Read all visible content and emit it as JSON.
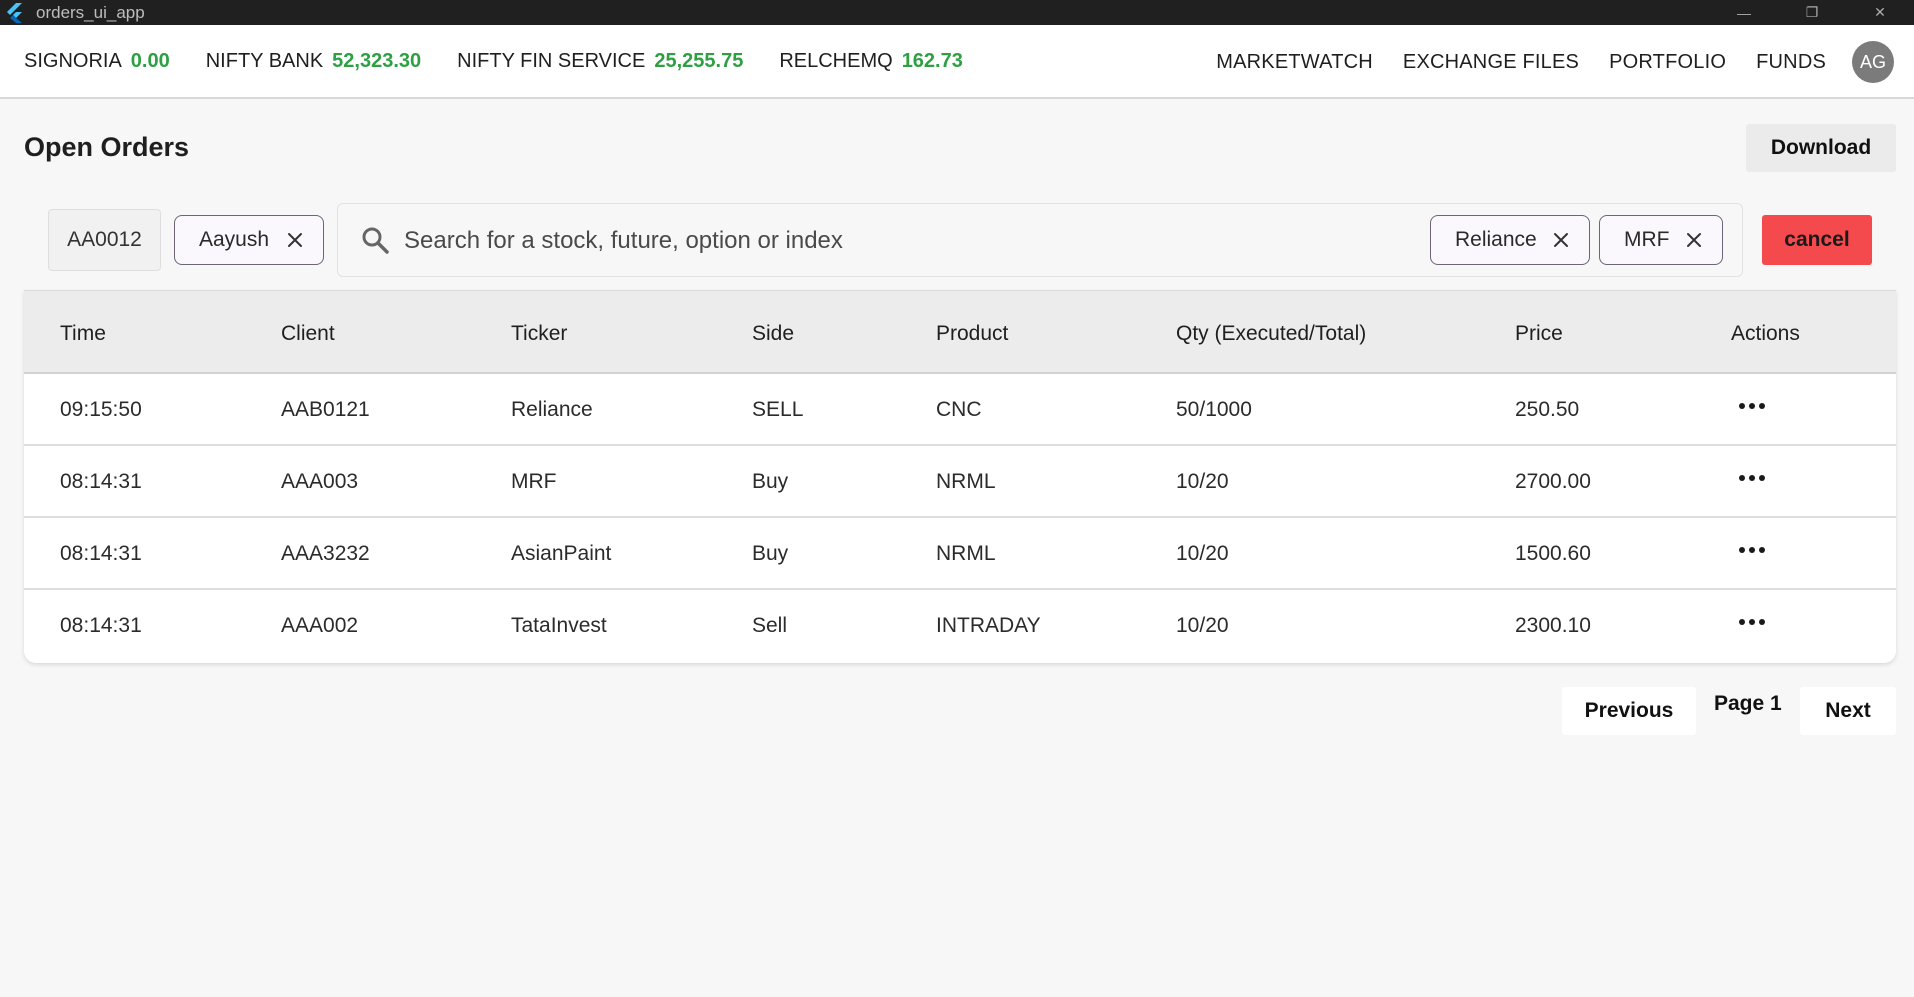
{
  "window": {
    "title": "orders_ui_app",
    "minimize_glyph": "—",
    "restore_glyph": "❐",
    "close_glyph": "✕"
  },
  "topnav": {
    "tickers": [
      {
        "name": "SIGNORIA",
        "value": "0.00"
      },
      {
        "name": "NIFTY BANK",
        "value": "52,323.30"
      },
      {
        "name": "NIFTY FIN SERVICE",
        "value": "25,255.75"
      },
      {
        "name": "RELCHEMQ",
        "value": "162.73"
      }
    ],
    "links": [
      "MARKETWATCH",
      "EXCHANGE FILES",
      "PORTFOLIO",
      "FUNDS"
    ],
    "avatar": "AG"
  },
  "page": {
    "title": "Open Orders",
    "download_label": "Download"
  },
  "filters": {
    "client_code": "AA0012",
    "client_chip": "Aayush",
    "search_placeholder": "Search for a stock, future, option or index",
    "stock_chips": [
      "Reliance",
      "MRF"
    ],
    "cancel_label": "cancel"
  },
  "table": {
    "columns": [
      "Time",
      "Client",
      "Ticker",
      "Side",
      "Product",
      "Qty (Executed/Total)",
      "Price",
      "Actions"
    ],
    "rows": [
      {
        "time": "09:15:50",
        "client": "AAB0121",
        "ticker": "Reliance",
        "side": "SELL",
        "product": "CNC",
        "qty": "50/1000",
        "price": "250.50"
      },
      {
        "time": "08:14:31",
        "client": "AAA003",
        "ticker": "MRF",
        "side": "Buy",
        "product": "NRML",
        "qty": "10/20",
        "price": "2700.00"
      },
      {
        "time": "08:14:31",
        "client": "AAA3232",
        "ticker": "AsianPaint",
        "side": "Buy",
        "product": "NRML",
        "qty": "10/20",
        "price": "1500.60"
      },
      {
        "time": "08:14:31",
        "client": "AAA002",
        "ticker": "TataInvest",
        "side": "Sell",
        "product": "INTRADAY",
        "qty": "10/20",
        "price": "2300.10"
      }
    ],
    "row_action_icon": "more-horizontal-icon"
  },
  "pagination": {
    "previous_label": "Previous",
    "page_label": "Page 1",
    "next_label": "Next"
  },
  "colors": {
    "ticker_value": "#2ea043",
    "cancel_button": "#f4494d",
    "titlebar": "#202020",
    "avatar": "#7b7b7b"
  }
}
